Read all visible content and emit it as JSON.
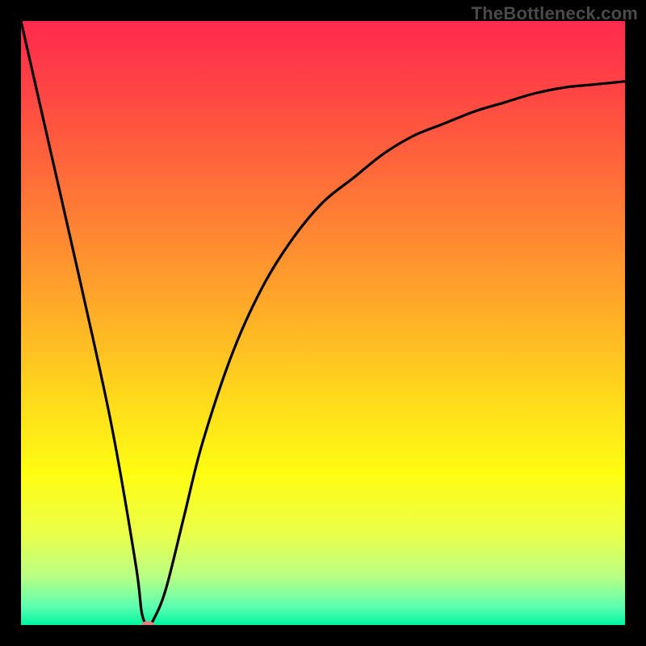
{
  "watermark": "TheBottleneck.com",
  "chart_data": {
    "type": "line",
    "title": "",
    "xlabel": "",
    "ylabel": "",
    "xlim": [
      0,
      100
    ],
    "ylim": [
      0,
      100
    ],
    "grid": false,
    "legend": false,
    "series": [
      {
        "name": "bottleneck-curve",
        "x": [
          0,
          5,
          10,
          15,
          19,
          20,
          21,
          22,
          24,
          27,
          30,
          35,
          40,
          45,
          50,
          55,
          60,
          65,
          70,
          75,
          80,
          85,
          90,
          95,
          100
        ],
        "y": [
          100,
          78,
          56,
          33,
          10,
          2,
          0,
          1,
          6,
          18,
          30,
          45,
          56,
          64,
          70,
          74,
          78,
          81,
          83,
          85,
          86.5,
          88,
          89,
          89.5,
          90
        ]
      }
    ],
    "marker": {
      "x": 21,
      "y": 0,
      "name": "optimal-point"
    },
    "gradient_stops": [
      {
        "pos": 0,
        "color": "#ff2a4d"
      },
      {
        "pos": 12,
        "color": "#ff4644"
      },
      {
        "pos": 25,
        "color": "#ff6a3a"
      },
      {
        "pos": 38,
        "color": "#ff8e30"
      },
      {
        "pos": 50,
        "color": "#ffb326"
      },
      {
        "pos": 62,
        "color": "#ffd81c"
      },
      {
        "pos": 75,
        "color": "#fffd12"
      },
      {
        "pos": 85,
        "color": "#eaff4a"
      },
      {
        "pos": 92,
        "color": "#b8ff85"
      },
      {
        "pos": 97,
        "color": "#5cffb0"
      },
      {
        "pos": 100,
        "color": "#00f5a0"
      }
    ]
  }
}
